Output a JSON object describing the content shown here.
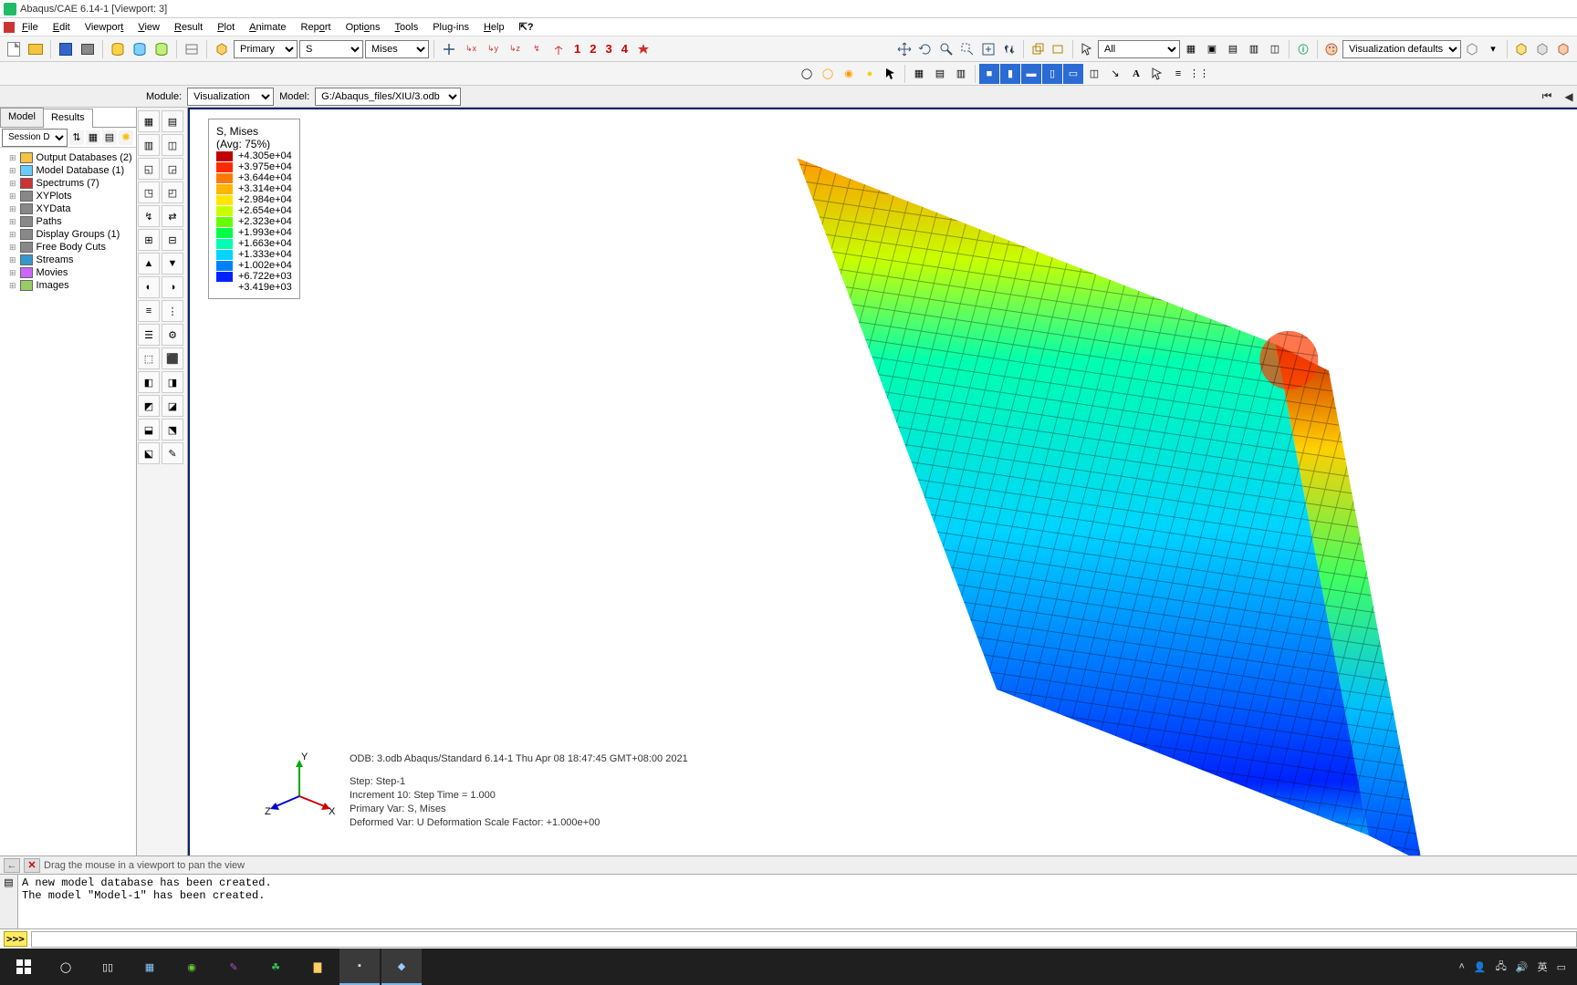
{
  "title": "Abaqus/CAE 6.14-1  [Viewport: 3]",
  "menu": [
    "File",
    "Edit",
    "Viewport",
    "View",
    "Result",
    "Plot",
    "Animate",
    "Report",
    "Options",
    "Tools",
    "Plug-ins",
    "Help"
  ],
  "field_output": {
    "position": "Primary",
    "variable": "S",
    "component": "Mises"
  },
  "red_numbers": [
    "1",
    "2",
    "3",
    "4"
  ],
  "selection_filter": "All",
  "render_style_label": "Visualization defaults",
  "context": {
    "module_label": "Module:",
    "module": "Visualization",
    "model_label": "Model:",
    "model": "G:/Abaqus_files/XIU/3.odb"
  },
  "tabs": {
    "model": "Model",
    "results": "Results",
    "active": "Results"
  },
  "session_combo": "Session Data",
  "tree": [
    {
      "icon": "db",
      "label": "Output Databases (2)"
    },
    {
      "icon": "mdb",
      "label": "Model Database (1)"
    },
    {
      "icon": "spec",
      "label": "Spectrums (7)"
    },
    {
      "icon": "xy",
      "label": "XYPlots"
    },
    {
      "icon": "xy",
      "label": "XYData"
    },
    {
      "icon": "path",
      "label": "Paths"
    },
    {
      "icon": "dg",
      "label": "Display Groups (1)"
    },
    {
      "icon": "fbc",
      "label": "Free Body Cuts"
    },
    {
      "icon": "str",
      "label": "Streams"
    },
    {
      "icon": "mov",
      "label": "Movies"
    },
    {
      "icon": "img",
      "label": "Images"
    }
  ],
  "legend": {
    "title": "S, Mises",
    "subtitle": "(Avg: 75%)",
    "rows": [
      {
        "c": "#bf0000",
        "v": "+4.305e+04"
      },
      {
        "c": "#ff2a00",
        "v": "+3.975e+04"
      },
      {
        "c": "#ff7a00",
        "v": "+3.644e+04"
      },
      {
        "c": "#ffb400",
        "v": "+3.314e+04"
      },
      {
        "c": "#ffe600",
        "v": "+2.984e+04"
      },
      {
        "c": "#c8ff00",
        "v": "+2.654e+04"
      },
      {
        "c": "#66ff00",
        "v": "+2.323e+04"
      },
      {
        "c": "#00ff44",
        "v": "+1.993e+04"
      },
      {
        "c": "#00ffb0",
        "v": "+1.663e+04"
      },
      {
        "c": "#00d4ff",
        "v": "+1.333e+04"
      },
      {
        "c": "#0080ff",
        "v": "+1.002e+04"
      },
      {
        "c": "#0022ff",
        "v": "+6.722e+03"
      },
      {
        "c": "",
        "v": "+3.419e+03"
      }
    ]
  },
  "annot": {
    "l1": "ODB: 3.odb    Abaqus/Standard 6.14-1    Thu Apr 08 18:47:45 GMT+08:00 2021",
    "l2": "Step: Step-1",
    "l3": "Increment     10: Step Time =    1.000",
    "l4": "Primary Var: S, Mises",
    "l5": "Deformed Var: U   Deformation Scale Factor: +1.000e+00"
  },
  "triad": {
    "x": "X",
    "y": "Y",
    "z": "Z"
  },
  "prompt_text": "Drag the mouse in a viewport to pan the view",
  "console_lines": "A new model database has been created.\nThe model \"Model-1\" has been created.",
  "taskbar": {
    "time": "",
    "lang": "英",
    "icons": [
      "network",
      "sound"
    ]
  }
}
